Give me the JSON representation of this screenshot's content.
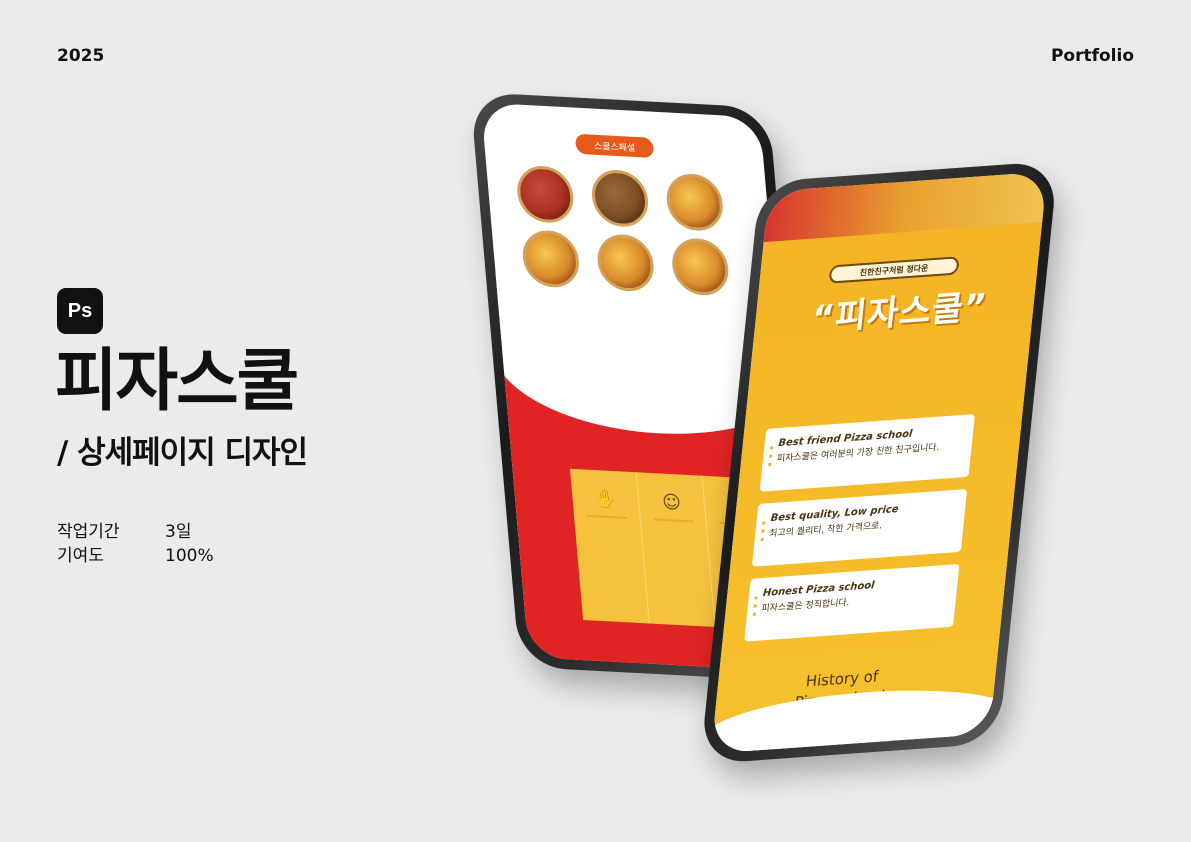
{
  "header": {
    "year": "2025",
    "portfolio": "Portfolio"
  },
  "app_badge": {
    "label": "Ps"
  },
  "project": {
    "title": "피자스쿨",
    "subtitle": "/ 상세페이지 디자인",
    "meta": [
      {
        "key": "작업기간",
        "value": "3일"
      },
      {
        "key": "기여도",
        "value": "100%"
      }
    ]
  },
  "phone_left": {
    "pill": "스쿨스페셜",
    "features": [
      {
        "icon": "thumbs-up-icon",
        "glyph": "✋"
      },
      {
        "icon": "family-icon",
        "glyph": "☺"
      },
      {
        "icon": "award-icon",
        "glyph": "✪"
      }
    ]
  },
  "phone_right": {
    "pill": "친한친구처럼 정다운",
    "title": "“피자스쿨”",
    "cards": [
      {
        "en": "Best friend Pizza school",
        "kr": "피자스쿨은 여러분의 가장 친한 친구입니다."
      },
      {
        "en": "Best quality, Low price",
        "kr": "최고의 퀄리티, 착한 가격으로."
      },
      {
        "en": "Honest Pizza school",
        "kr": "피자스쿨은 정직합니다."
      }
    ],
    "history_line1": "History of",
    "history_line2": "Pizza school"
  },
  "colors": {
    "brand_red": "#e02424",
    "brand_yellow": "#f6c23e",
    "brand_orange": "#e85a1b",
    "brown_text": "#4a3310"
  }
}
